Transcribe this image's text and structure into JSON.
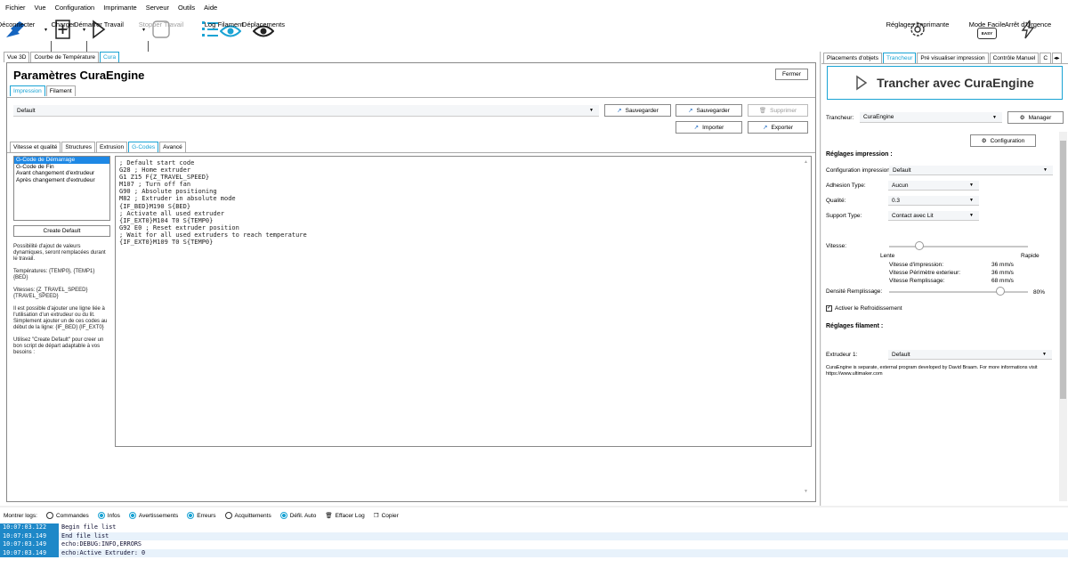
{
  "menu": [
    "Fichier",
    "Vue",
    "Configuration",
    "Imprimante",
    "Serveur",
    "Outils",
    "Aide"
  ],
  "toolbar": {
    "disconnect": "Déconnecter",
    "load": "Charger",
    "start": "Démarrer Travail",
    "stop": "Stopper Travail",
    "log": "Log",
    "filament": "Filament",
    "moves": "Déplacements",
    "printer_settings": "Réglages imprimante",
    "easy_mode": "Mode Facile",
    "easy_badge": "EASY",
    "emergency": "Arrêt d'Urgence"
  },
  "left_tabs": [
    "Vue 3D",
    "Courbe de Température",
    "Cura"
  ],
  "panel": {
    "title": "Paramètres CuraEngine",
    "close": "Fermer",
    "subtabs": [
      "Impression",
      "Filament"
    ],
    "profile": "Default",
    "save1": "Sauvegarder",
    "save2": "Sauvegarder",
    "delete": "Supprimer",
    "import": "Importer",
    "export": "Exporter",
    "inner_tabs": [
      "Vitesse et qualité",
      "Structures",
      "Extrusion",
      "G-Codes",
      "Avancé"
    ],
    "gcode_items": [
      "G-Code de Démarrage",
      "G-Code de Fin",
      "Avant changement d'extrudeur",
      "Après changement d'extrudeur"
    ],
    "create_default": "Create Default",
    "help": [
      "Possibilité d'ajout de valeurs dynamiques, seront remplacées durant le travail.",
      "Températures: {TEMP0}, {TEMP1} {BED}",
      "Vitesses: {Z_TRAVEL_SPEED} {TRAVEL_SPEED}",
      "Il est possible d'ajouter une ligne liée à l'utilisation d'un extrudeur ou du lit. Simplement ajouter un de ces codes au début de la ligne: {IF_BED} {IF_EXT0}",
      "Utilisez \"Create Default\" pour creer un bon script de départ adaptable à vos besoins :"
    ],
    "gcode": "; Default start code\nG28 ; Home extruder\nG1 Z15 F{Z_TRAVEL_SPEED}\nM107 ; Turn off fan\nG90 ; Absolute positioning\nM82 ; Extruder in absolute mode\n{IF_BED}M190 S{BED}\n; Activate all used extruder\n{IF_EXT0}M104 T0 S{TEMP0}\nG92 E0 ; Reset extruder position\n; Wait for all used extruders to reach temperature\n{IF_EXT0}M109 T0 S{TEMP0}"
  },
  "right_tabs": [
    "Placements d'objets",
    "Trancheur",
    "Pré visualiser impression",
    "Contrôle Manuel",
    "C"
  ],
  "slicer": {
    "slice_button": "Trancher avec CuraEngine",
    "slicer_label": "Trancheur:",
    "slicer_value": "CuraEngine",
    "manager": "Manager",
    "configuration": "Configuration",
    "print_settings": "Réglages impression :",
    "config_label": "Configuration impression:",
    "config_value": "Default",
    "adhesion_label": "Adhesion Type:",
    "adhesion_value": "Aucun",
    "quality_label": "Qualité:",
    "quality_value": "0.3",
    "support_label": "Support Type:",
    "support_value": "Contact avec Lit",
    "speed_label": "Vitesse:",
    "speed_slow": "Lente",
    "speed_fast": "Rapide",
    "speed_level": 0.22,
    "print_speed_label": "Vitesse d'impression:",
    "print_speed_value": "36 mm/s",
    "perimeter_label": "Vitesse Périmètre exterieur:",
    "perimeter_value": "36 mm/s",
    "infill_speed_label": "Vitesse Remplissage:",
    "infill_speed_value": "68 mm/s",
    "density_label": "Densité Remplissage:",
    "density_value": "80%",
    "density_level": 0.8,
    "cooling": "Activer le Refroidissement",
    "filament_settings": "Réglages filament :",
    "extruder_label": "Extrudeur 1:",
    "extruder_value": "Default",
    "info": "CuraEngine is separate, external program developed by David Braam. For more informations visit https://www.ultimaker.com"
  },
  "logbar": {
    "show": "Montrer logs:",
    "commands": "Commandes",
    "infos": "Infos",
    "warnings": "Avertissements",
    "errors": "Erreurs",
    "acks": "Acquittements",
    "autoscroll": "Défil. Auto",
    "clear": "Effacer Log",
    "copy": "Copier"
  },
  "logs": [
    {
      "ts": "10:07:03.122",
      "msg": "Begin file list"
    },
    {
      "ts": "10:07:03.149",
      "msg": "End file list"
    },
    {
      "ts": "10:07:03.149",
      "msg": "echo:DEBUG:INFO,ERRORS"
    },
    {
      "ts": "10:07:03.149",
      "msg": "echo:Active Extruder: 0"
    }
  ],
  "colors": {
    "accent": "#1aa3d4",
    "log_ts": "#1e88c8",
    "icon": "#1565c0"
  }
}
